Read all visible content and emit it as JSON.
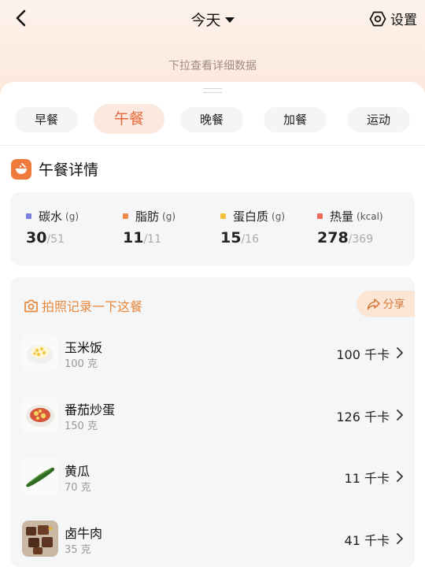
{
  "header": {
    "title": "今天",
    "settings_label": "设置",
    "pull_hint": "下拉查看详细数据"
  },
  "tabs": [
    {
      "label": "早餐"
    },
    {
      "label": "午餐"
    },
    {
      "label": "晚餐"
    },
    {
      "label": "加餐"
    },
    {
      "label": "运动"
    }
  ],
  "active_tab": "午餐",
  "detail": {
    "title": "午餐详情"
  },
  "nutrition": [
    {
      "name": "碳水",
      "unit": "(g)",
      "current": "30",
      "total": "/51",
      "color": "#7b7fe0"
    },
    {
      "name": "脂肪",
      "unit": "(g)",
      "current": "11",
      "total": "/11",
      "color": "#f08a4b"
    },
    {
      "name": "蛋白质",
      "unit": "(g)",
      "current": "15",
      "total": "/16",
      "color": "#f5c13c"
    },
    {
      "name": "热量",
      "unit": "(kcal)",
      "current": "278",
      "total": "/369",
      "color": "#ef6b57"
    }
  ],
  "photo": {
    "label": "拍照记录一下这餐",
    "share_label": "分享"
  },
  "foods": [
    {
      "name": "玉米饭",
      "weight": "100 克",
      "kcal": "100 千卡",
      "icon": "corn-rice-icon"
    },
    {
      "name": "番茄炒蛋",
      "weight": "150 克",
      "kcal": "126 千卡",
      "icon": "tomato-egg-icon"
    },
    {
      "name": "黄瓜",
      "weight": "70 克",
      "kcal": "11 千卡",
      "icon": "cucumber-icon"
    },
    {
      "name": "卤牛肉",
      "weight": "35 克",
      "kcal": "41 千卡",
      "icon": "braised-beef-icon"
    }
  ],
  "colors": {
    "accent": "#e8683a",
    "photo_accent": "#e8873a"
  }
}
